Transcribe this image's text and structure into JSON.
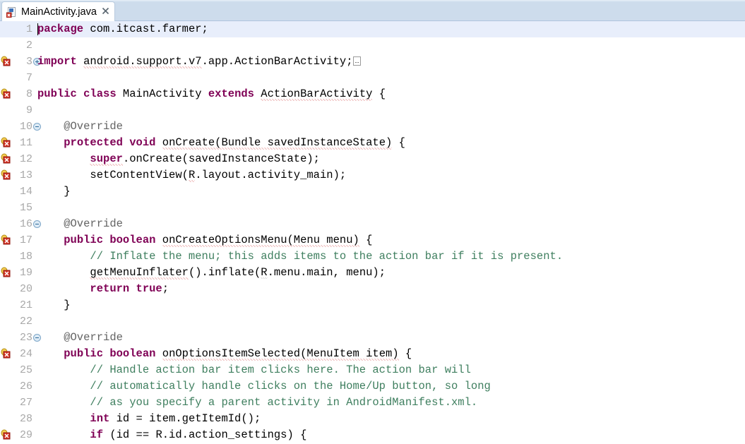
{
  "window": {
    "app": "Eclipse IDE Java Editor",
    "tab": {
      "label": "MainActivity.java",
      "close_glyph": "✖",
      "icon_name": "java-file-error-icon",
      "has_error_badge": true
    },
    "tabbar_color": "#cddcec",
    "editor_bg": "#ffffff",
    "current_line_color": "#e8eefb"
  },
  "editor": {
    "current_line": 1,
    "first_visible_line": 1,
    "last_visible_line": 29,
    "line_height_px": 23,
    "colors": {
      "keyword": "#7f0055",
      "comment": "#3f7f5f",
      "annotation": "#646464",
      "line_number": "#a8a8a8",
      "error_squiggle": "#d03c3c",
      "text": "#000000"
    },
    "lines": [
      {
        "num": "1",
        "marker": "none",
        "fold": "none",
        "current": true,
        "tokens": [
          {
            "t": "package",
            "c": "kw"
          },
          {
            "t": " com.itcast.farmer;",
            "c": "plain"
          }
        ]
      },
      {
        "num": "2",
        "marker": "none",
        "fold": "none",
        "current": false,
        "tokens": []
      },
      {
        "num": "3",
        "marker": "warning-error",
        "fold": "plus",
        "current": false,
        "tokens": [
          {
            "t": "import",
            "c": "kw"
          },
          {
            "t": " ",
            "c": "plain"
          },
          {
            "t": "android.support.v7",
            "c": "sq"
          },
          {
            "t": ".app.ActionBarActivity;",
            "c": "plain"
          },
          {
            "t": "FOLDBOX",
            "c": "foldbox"
          }
        ]
      },
      {
        "num": "7",
        "marker": "none",
        "fold": "none",
        "current": false,
        "tokens": []
      },
      {
        "num": "8",
        "marker": "warning-error",
        "fold": "none",
        "current": false,
        "tokens": [
          {
            "t": "public class",
            "c": "kw"
          },
          {
            "t": " MainActivity ",
            "c": "plain"
          },
          {
            "t": "extends",
            "c": "kw"
          },
          {
            "t": " ",
            "c": "plain"
          },
          {
            "t": "ActionBarActivity",
            "c": "sq"
          },
          {
            "t": " {",
            "c": "plain"
          }
        ]
      },
      {
        "num": "9",
        "marker": "none",
        "fold": "none",
        "current": false,
        "tokens": []
      },
      {
        "num": "10",
        "marker": "none",
        "fold": "minus",
        "current": false,
        "tokens": [
          {
            "t": "    @Override",
            "c": "ann"
          }
        ]
      },
      {
        "num": "11",
        "marker": "warning-error",
        "fold": "none",
        "current": false,
        "tokens": [
          {
            "t": "    ",
            "c": "plain"
          },
          {
            "t": "protected void",
            "c": "kw"
          },
          {
            "t": " ",
            "c": "plain"
          },
          {
            "t": "onCreate(Bundle savedInstanceState)",
            "c": "sq"
          },
          {
            "t": " {",
            "c": "plain"
          }
        ]
      },
      {
        "num": "12",
        "marker": "warning-error",
        "fold": "none",
        "current": false,
        "tokens": [
          {
            "t": "        ",
            "c": "plain"
          },
          {
            "t": "super",
            "c": "kwsq"
          },
          {
            "t": ".onCreate(savedInstanceState);",
            "c": "plain"
          }
        ]
      },
      {
        "num": "13",
        "marker": "warning-error",
        "fold": "none",
        "current": false,
        "tokens": [
          {
            "t": "        setContentView(",
            "c": "plain"
          },
          {
            "t": "R",
            "c": "sq"
          },
          {
            "t": ".layout.activity_main);",
            "c": "plain"
          }
        ]
      },
      {
        "num": "14",
        "marker": "none",
        "fold": "none",
        "current": false,
        "tokens": [
          {
            "t": "    }",
            "c": "plain"
          }
        ]
      },
      {
        "num": "15",
        "marker": "none",
        "fold": "none",
        "current": false,
        "tokens": []
      },
      {
        "num": "16",
        "marker": "none",
        "fold": "minus",
        "current": false,
        "tokens": [
          {
            "t": "    @Override",
            "c": "ann"
          }
        ]
      },
      {
        "num": "17",
        "marker": "warning-error",
        "fold": "none",
        "current": false,
        "tokens": [
          {
            "t": "    ",
            "c": "plain"
          },
          {
            "t": "public boolean",
            "c": "kw"
          },
          {
            "t": " ",
            "c": "plain"
          },
          {
            "t": "onCreateOptionsMenu(Menu menu)",
            "c": "sq"
          },
          {
            "t": " {",
            "c": "plain"
          }
        ]
      },
      {
        "num": "18",
        "marker": "none",
        "fold": "none",
        "current": false,
        "tokens": [
          {
            "t": "        // Inflate the menu; this adds items to the action bar if it is present.",
            "c": "cmt"
          }
        ]
      },
      {
        "num": "19",
        "marker": "warning-error",
        "fold": "none",
        "current": false,
        "tokens": [
          {
            "t": "        ",
            "c": "plain"
          },
          {
            "t": "getMenuInflater",
            "c": "sq"
          },
          {
            "t": "().inflate(",
            "c": "plain"
          },
          {
            "t": "R",
            "c": "sqd"
          },
          {
            "t": ".menu.main, menu);",
            "c": "plain"
          }
        ]
      },
      {
        "num": "20",
        "marker": "none",
        "fold": "none",
        "current": false,
        "tokens": [
          {
            "t": "        ",
            "c": "plain"
          },
          {
            "t": "return true",
            "c": "kw"
          },
          {
            "t": ";",
            "c": "plain"
          }
        ]
      },
      {
        "num": "21",
        "marker": "none",
        "fold": "none",
        "current": false,
        "tokens": [
          {
            "t": "    }",
            "c": "plain"
          }
        ]
      },
      {
        "num": "22",
        "marker": "none",
        "fold": "none",
        "current": false,
        "tokens": []
      },
      {
        "num": "23",
        "marker": "none",
        "fold": "minus",
        "current": false,
        "tokens": [
          {
            "t": "    @Override",
            "c": "ann"
          }
        ]
      },
      {
        "num": "24",
        "marker": "warning-error",
        "fold": "none",
        "current": false,
        "tokens": [
          {
            "t": "    ",
            "c": "plain"
          },
          {
            "t": "public boolean",
            "c": "kw"
          },
          {
            "t": " ",
            "c": "plain"
          },
          {
            "t": "onOptionsItemSelected(MenuItem item)",
            "c": "sq"
          },
          {
            "t": " {",
            "c": "plain"
          }
        ]
      },
      {
        "num": "25",
        "marker": "none",
        "fold": "none",
        "current": false,
        "tokens": [
          {
            "t": "        // Handle action bar item clicks here. The action bar will",
            "c": "cmt"
          }
        ]
      },
      {
        "num": "26",
        "marker": "none",
        "fold": "none",
        "current": false,
        "tokens": [
          {
            "t": "        // automatically handle clicks on the Home/Up button, so long",
            "c": "cmt"
          }
        ]
      },
      {
        "num": "27",
        "marker": "none",
        "fold": "none",
        "current": false,
        "tokens": [
          {
            "t": "        // as you specify a parent activity in AndroidManifest.xml.",
            "c": "cmt"
          }
        ]
      },
      {
        "num": "28",
        "marker": "none",
        "fold": "none",
        "current": false,
        "tokens": [
          {
            "t": "        ",
            "c": "plain"
          },
          {
            "t": "int",
            "c": "kw"
          },
          {
            "t": " id = item.getItemId();",
            "c": "plain"
          }
        ]
      },
      {
        "num": "29",
        "marker": "warning-error",
        "fold": "none",
        "current": false,
        "clipped": true,
        "tokens": [
          {
            "t": "        ",
            "c": "plain"
          },
          {
            "t": "if",
            "c": "kw"
          },
          {
            "t": " (id == R.id.action_settings) {",
            "c": "plain"
          }
        ]
      }
    ]
  }
}
